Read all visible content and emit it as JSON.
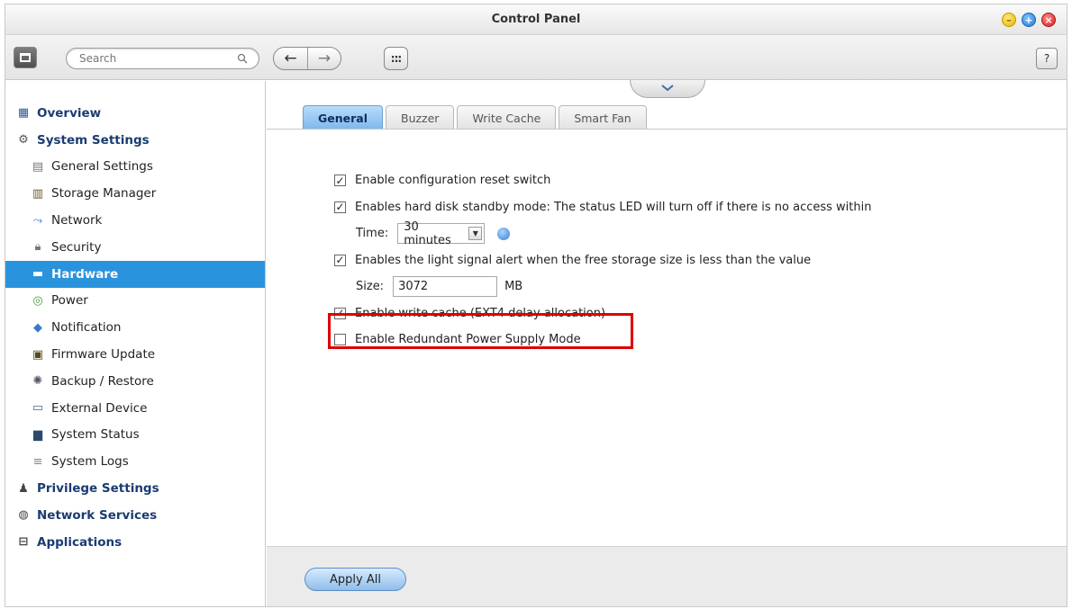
{
  "window": {
    "title": "Control Panel",
    "controls": [
      "minimize-icon",
      "maximize-icon",
      "close-icon"
    ]
  },
  "toolbar": {
    "search_placeholder": "Search",
    "back_label": "←",
    "forward_label": "→",
    "apps_label": ":::",
    "help_label": "?"
  },
  "sidebar": {
    "items": [
      {
        "label": "Overview",
        "level": "top",
        "icon": "grid-icon"
      },
      {
        "label": "System Settings",
        "level": "top",
        "icon": "gear-icon"
      },
      {
        "label": "General Settings",
        "level": "sub",
        "icon": "settings-sheet-icon"
      },
      {
        "label": "Storage Manager",
        "level": "sub",
        "icon": "storage-icon"
      },
      {
        "label": "Network",
        "level": "sub",
        "icon": "network-icon"
      },
      {
        "label": "Security",
        "level": "sub",
        "icon": "lock-icon"
      },
      {
        "label": "Hardware",
        "level": "sub",
        "icon": "hardware-icon",
        "active": true
      },
      {
        "label": "Power",
        "level": "sub",
        "icon": "power-bulb-icon"
      },
      {
        "label": "Notification",
        "level": "sub",
        "icon": "notification-icon"
      },
      {
        "label": "Firmware Update",
        "level": "sub",
        "icon": "firmware-icon"
      },
      {
        "label": "Backup / Restore",
        "level": "sub",
        "icon": "backup-icon"
      },
      {
        "label": "External Device",
        "level": "sub",
        "icon": "external-device-icon"
      },
      {
        "label": "System Status",
        "level": "sub",
        "icon": "monitor-icon"
      },
      {
        "label": "System Logs",
        "level": "sub",
        "icon": "log-icon"
      },
      {
        "label": "Privilege Settings",
        "level": "top",
        "icon": "user-icon"
      },
      {
        "label": "Network Services",
        "level": "top",
        "icon": "globe-icon"
      },
      {
        "label": "Applications",
        "level": "top",
        "icon": "applications-icon"
      }
    ]
  },
  "tabs": [
    {
      "label": "General",
      "active": true
    },
    {
      "label": "Buzzer",
      "active": false
    },
    {
      "label": "Write Cache",
      "active": false
    },
    {
      "label": "Smart Fan",
      "active": false
    }
  ],
  "options": {
    "reset_switch": {
      "label": "Enable configuration reset switch",
      "checked": true
    },
    "hdd_standby": {
      "label": "Enables hard disk standby mode: The status LED will turn off if there is no access within",
      "checked": true
    },
    "time_label": "Time:",
    "time_value": "30 minutes",
    "light_alert": {
      "label": "Enables the light signal alert when the free storage size is less than the value",
      "checked": true
    },
    "size_label": "Size:",
    "size_value": "3072",
    "size_unit": "MB",
    "write_cache": {
      "label": "Enable write cache (EXT4 delay allocation)",
      "checked": true
    },
    "redundant_power": {
      "label": "Enable Redundant Power Supply Mode",
      "checked": false
    }
  },
  "footer": {
    "apply_label": "Apply All"
  },
  "colors": {
    "accent": "#2a93de",
    "highlight_box": "#e00000",
    "top_item_text": "#1a3c72"
  }
}
